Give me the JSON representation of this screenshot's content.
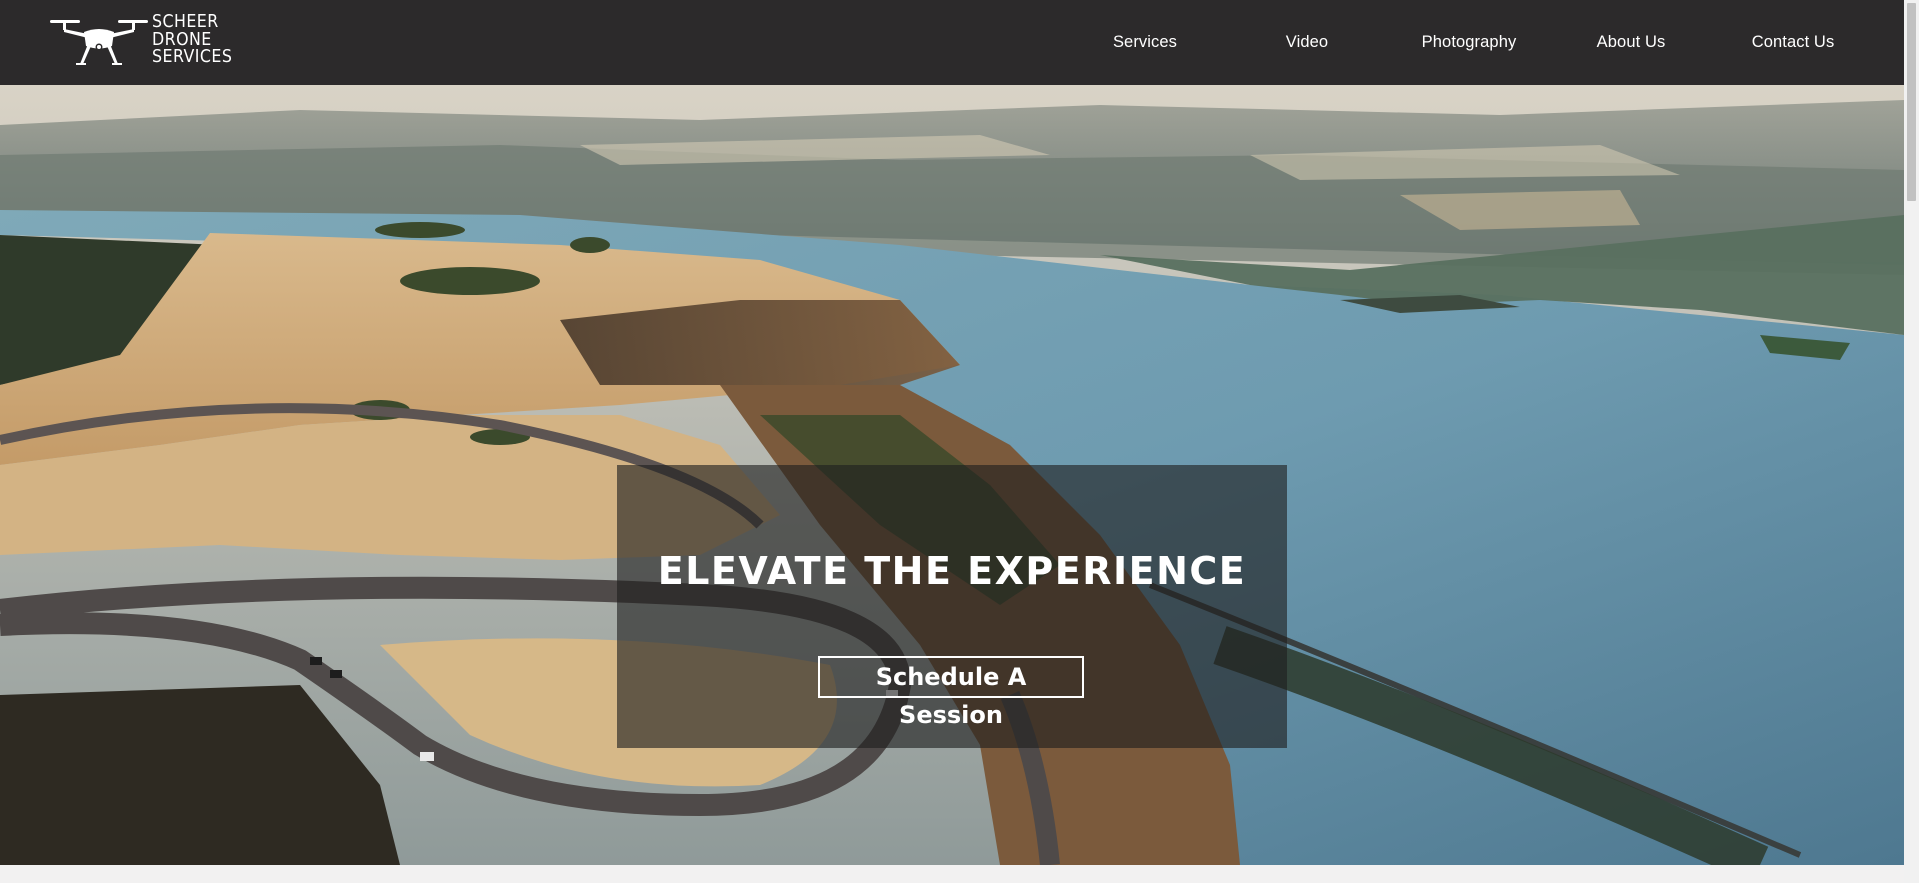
{
  "brand": {
    "logo_lines": [
      "SCHEER",
      "DRONE",
      "SERVICES"
    ],
    "logo_icon": "drone-icon"
  },
  "nav": {
    "items": [
      {
        "label": "Services"
      },
      {
        "label": "Video"
      },
      {
        "label": "Photography"
      },
      {
        "label": "About Us"
      },
      {
        "label": "Contact Us"
      }
    ]
  },
  "hero": {
    "headline": "ELEVATE THE  EXPERIENCE",
    "cta_label": "Schedule A Session",
    "background": "aerial-river-gorge-photo"
  },
  "colors": {
    "header_bg": "#2c2a2b",
    "overlay_bg": "rgba(30,30,30,0.62)",
    "text": "#ffffff"
  }
}
